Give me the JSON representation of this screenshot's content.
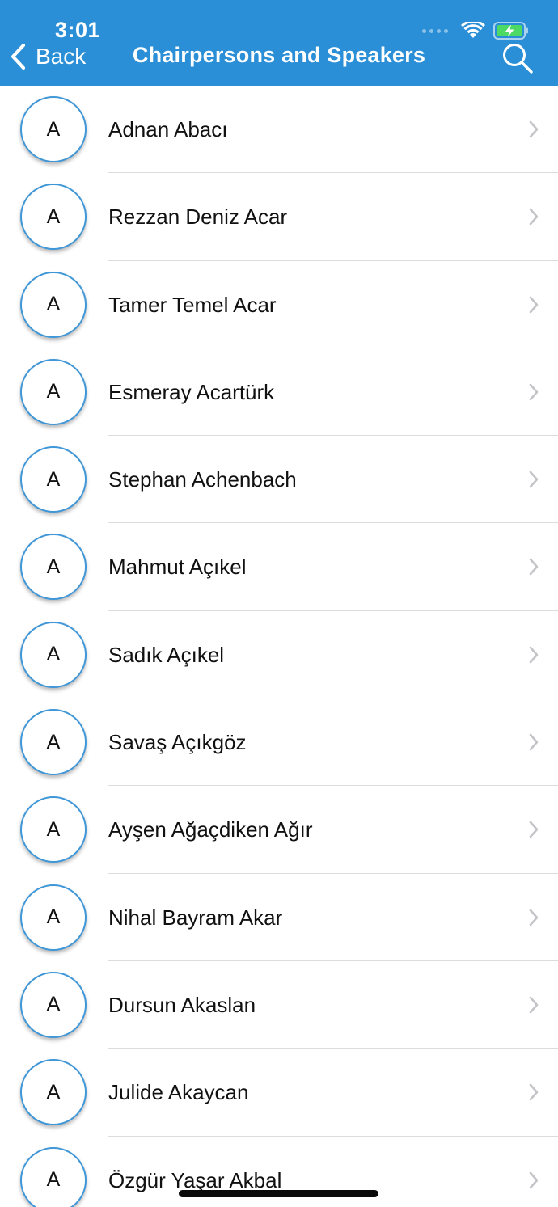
{
  "status_bar": {
    "time": "3:01"
  },
  "header": {
    "back_label": "Back",
    "title": "Chairpersons and Speakers",
    "accent_color": "#2a8fd6"
  },
  "speakers": [
    {
      "initial": "A",
      "name": "Adnan Abacı"
    },
    {
      "initial": "A",
      "name": "Rezzan Deniz Acar"
    },
    {
      "initial": "A",
      "name": "Tamer Temel Acar"
    },
    {
      "initial": "A",
      "name": "Esmeray Acartürk"
    },
    {
      "initial": "A",
      "name": "Stephan Achenbach"
    },
    {
      "initial": "A",
      "name": "Mahmut Açıkel"
    },
    {
      "initial": "A",
      "name": "Sadık Açıkel"
    },
    {
      "initial": "A",
      "name": "Savaş Açıkgöz"
    },
    {
      "initial": "A",
      "name": "Ayşen Ağaçdiken Ağır"
    },
    {
      "initial": "A",
      "name": "Nihal Bayram Akar"
    },
    {
      "initial": "A",
      "name": "Dursun Akaslan"
    },
    {
      "initial": "A",
      "name": "Julide Akaycan"
    },
    {
      "initial": "A",
      "name": "Özgür Yaşar Akbal"
    }
  ]
}
